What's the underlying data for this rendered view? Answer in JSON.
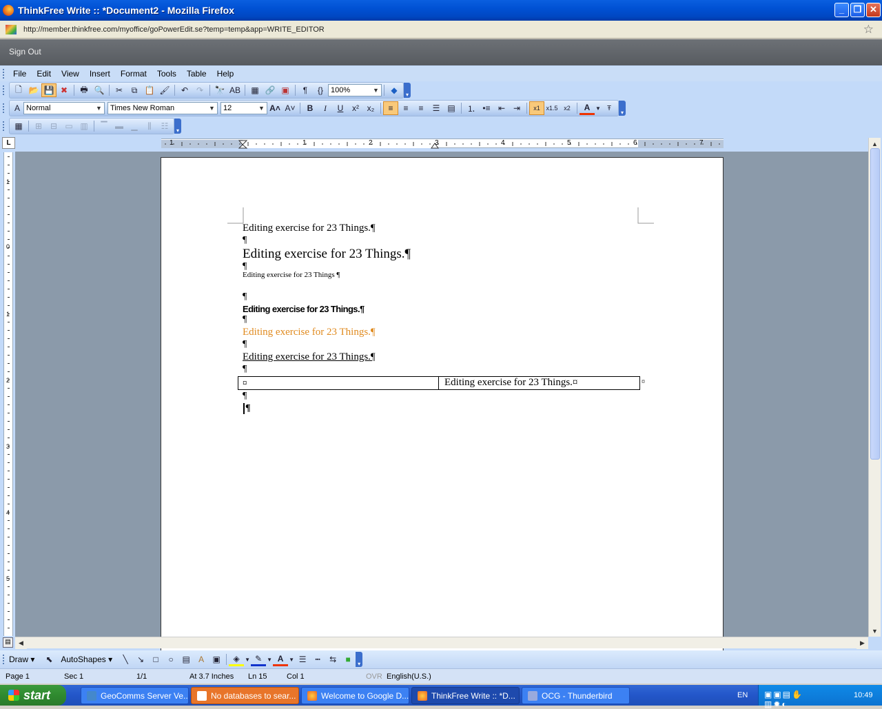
{
  "window": {
    "title": "ThinkFree Write :: *Document2 - Mozilla Firefox",
    "minimize": "_",
    "restore": "❐",
    "close": "✕"
  },
  "urlbar": {
    "url": "http://member.thinkfree.com/myoffice/goPowerEdit.se?temp=temp&app=WRITE_EDITOR"
  },
  "topbar": {
    "sign_out": "Sign Out"
  },
  "menu": [
    "File",
    "Edit",
    "View",
    "Insert",
    "Format",
    "Tools",
    "Table",
    "Help"
  ],
  "toolbar": {
    "zoom": "100%",
    "style": "Normal",
    "font": "Times New Roman",
    "size": "12"
  },
  "ruler": {
    "corner": "L",
    "marks": [
      "1",
      "1",
      "2",
      "3",
      "4",
      "5",
      "6",
      "7"
    ],
    "vmarks": [
      "1",
      "0",
      "1",
      "2",
      "3",
      "4",
      "5"
    ]
  },
  "document": {
    "line1": "Editing exercise for 23 Things.¶",
    "line2": "Editing exercise for 23 Things.¶",
    "line3": "Editing exercise for 23 Things ¶",
    "line4": "Editing exercise for 23 Things.¶",
    "line5": "Editing exercise for 23 Things.¶",
    "line6": "Editing exercise for 23 Things.¶",
    "table_cell1": "¤",
    "table_cell2": "Editing exercise for 23 Things.¤",
    "table_end": "¤",
    "para_mark": "¶",
    "colors": {
      "orange": "#e08a1e"
    }
  },
  "drawbar": {
    "draw": "Draw ▾",
    "autoshapes": "AutoShapes ▾"
  },
  "status": {
    "page": "Page 1",
    "sec": "Sec 1",
    "pages": "1/1",
    "at": "At 3.7 Inches",
    "ln": "Ln 15",
    "col": "Col 1",
    "ovr": "OVR",
    "lang": "English(U.S.)"
  },
  "taskbar": {
    "start": "start",
    "items": [
      "GeoComms Server Ve...",
      "No databases to sear...",
      "Welcome to Google D...",
      "ThinkFree Write :: *D...",
      "OCG - Thunderbird"
    ],
    "lang": "EN",
    "clock": "10:49"
  }
}
